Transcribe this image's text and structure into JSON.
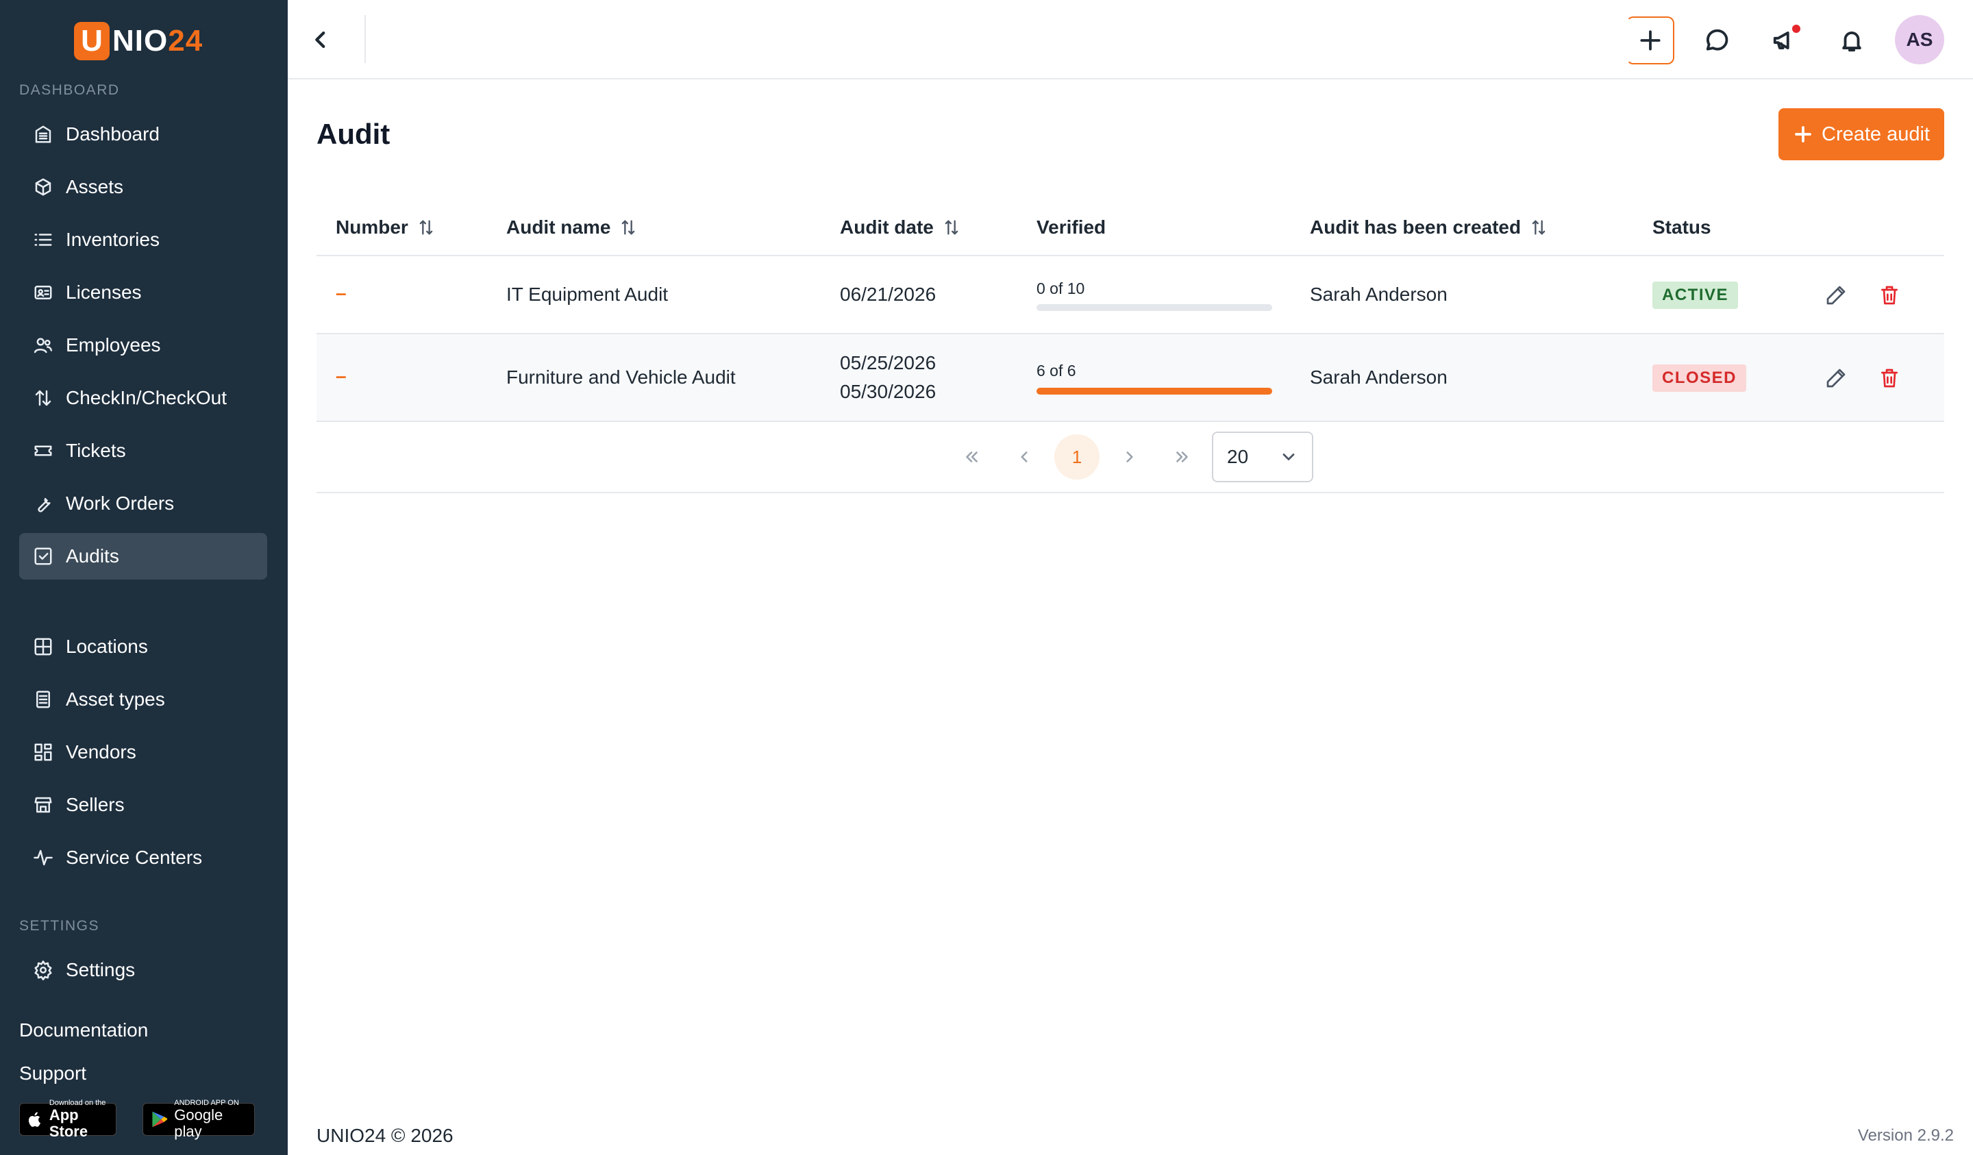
{
  "brand": {
    "logo_letter": "U",
    "logo_text_main": "NIO",
    "logo_text_accent": "24",
    "accent_color": "#f26e1a",
    "sidebar_color": "#1e2f3e"
  },
  "sidebar": {
    "section_dashboard": "DASHBOARD",
    "items": [
      {
        "label": "Dashboard",
        "icon": "building-icon"
      },
      {
        "label": "Assets",
        "icon": "box-icon"
      },
      {
        "label": "Inventories",
        "icon": "list-icon"
      },
      {
        "label": "Licenses",
        "icon": "id-card-icon"
      },
      {
        "label": "Employees",
        "icon": "users-icon"
      },
      {
        "label": "CheckIn/CheckOut",
        "icon": "arrows-updown-icon"
      },
      {
        "label": "Tickets",
        "icon": "ticket-icon"
      },
      {
        "label": "Work Orders",
        "icon": "wrench-icon"
      },
      {
        "label": "Audits",
        "icon": "checkbox-icon",
        "active": true
      },
      {
        "label": "Locations",
        "icon": "grid-icon"
      },
      {
        "label": "Asset types",
        "icon": "document-icon"
      },
      {
        "label": "Vendors",
        "icon": "apps-icon"
      },
      {
        "label": "Sellers",
        "icon": "store-icon"
      },
      {
        "label": "Service Centers",
        "icon": "pulse-icon"
      }
    ],
    "section_settings": "SETTINGS",
    "settings_label": "Settings",
    "documentation": "Documentation",
    "support": "Support",
    "app_store_small": "Download on the",
    "app_store_big": "App Store",
    "google_play_small": "ANDROID APP ON",
    "google_play_big": "Google play"
  },
  "topbar": {
    "icons": [
      "back-icon",
      "plus-icon",
      "chat-icon",
      "megaphone-icon",
      "bell-icon"
    ],
    "avatar_initials": "AS"
  },
  "page": {
    "title": "Audit",
    "create_button": "Create audit"
  },
  "table": {
    "headers": {
      "number": "Number",
      "audit_name": "Audit name",
      "audit_date": "Audit date",
      "verified": "Verified",
      "created_by": "Audit has been created",
      "status": "Status"
    },
    "rows": [
      {
        "number": "–",
        "audit_name": "IT Equipment Audit",
        "date_start": "06/21/2026",
        "date_end": "",
        "verified_label": "0 of 10",
        "verified_fraction": 0,
        "created_by": "Sarah Anderson",
        "status": "ACTIVE"
      },
      {
        "number": "–",
        "audit_name": "Furniture and Vehicle Audit",
        "date_start": "05/25/2026",
        "date_end": "05/30/2026",
        "verified_label": "6 of 6",
        "verified_fraction": 1,
        "created_by": "Sarah Anderson",
        "status": "CLOSED"
      }
    ]
  },
  "pagination": {
    "current_page": "1",
    "page_size": "20"
  },
  "footer": {
    "copyright": "UNIO24 © 2026",
    "version": "Version 2.9.2"
  }
}
